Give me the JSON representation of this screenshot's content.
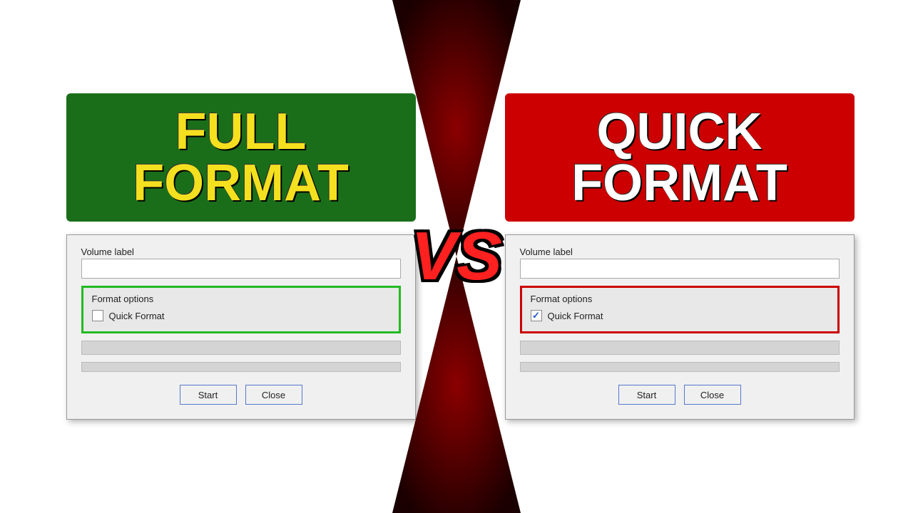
{
  "left": {
    "title_line1": "FULL",
    "title_line2": "FORMAT",
    "title_color": "yellow",
    "banner_color": "green",
    "dialog": {
      "volume_label": "Volume label",
      "format_options_label": "Format options",
      "checkbox_label": "Quick Format",
      "checkbox_checked": false,
      "border_style": "green",
      "start_btn": "Start",
      "close_btn": "Close"
    }
  },
  "right": {
    "title_line1": "QUICK",
    "title_line2": "FORMAT",
    "title_color": "white",
    "banner_color": "red",
    "dialog": {
      "volume_label": "Volume label",
      "format_options_label": "Format options",
      "checkbox_label": "Quick Format",
      "checkbox_checked": true,
      "border_style": "red",
      "start_btn": "Start",
      "close_btn": "Close"
    }
  },
  "vs_text": "VS",
  "icons": {
    "checkmark": "✓"
  }
}
